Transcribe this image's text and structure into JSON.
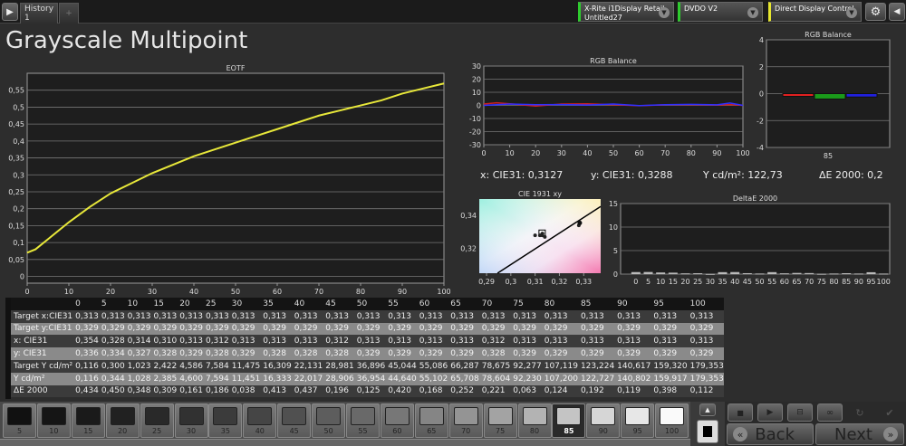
{
  "topbar": {
    "history_tab": "History 1",
    "add_tab": "+",
    "meter": {
      "line1": "X-Rite i1Display Retail",
      "line2": "Untitled27",
      "status_color": "#2ecc2e"
    },
    "source": {
      "label": "DVDO V2",
      "status_color": "#2ecc2e"
    },
    "display": {
      "label": "Direct Display Control",
      "status_color": "#e6e62e"
    }
  },
  "title": "Grayscale Multipoint",
  "readouts": {
    "x": "x: CIE31: 0,3127",
    "y": "y: CIE31: 0,3288",
    "Y": "Y cd/m²: 122,73",
    "de": "ΔE 2000: 0,2"
  },
  "chart_data": [
    {
      "type": "line",
      "title": "EOTF",
      "x": [
        0,
        2,
        5,
        8,
        10,
        15,
        20,
        25,
        30,
        35,
        40,
        45,
        50,
        55,
        60,
        65,
        70,
        75,
        80,
        85,
        90,
        95,
        100
      ],
      "values": [
        0.07,
        0.08,
        0.11,
        0.14,
        0.16,
        0.205,
        0.245,
        0.275,
        0.305,
        0.33,
        0.355,
        0.375,
        0.395,
        0.415,
        0.435,
        0.455,
        0.475,
        0.49,
        0.505,
        0.52,
        0.54,
        0.555,
        0.57
      ],
      "xlim": [
        0,
        100
      ],
      "ylim": [
        -0.02,
        0.6
      ],
      "xticks": [
        "0",
        "10",
        "20",
        "30",
        "40",
        "50",
        "60",
        "70",
        "80",
        "90",
        "100"
      ],
      "yticks": [
        "0",
        "0,05",
        "0,1",
        "0,15",
        "0,2",
        "0,25",
        "0,3",
        "0,35",
        "0,4",
        "0,45",
        "0,5",
        "0,55"
      ],
      "color": "#e8e83a"
    },
    {
      "type": "line",
      "title": "RGB Balance",
      "x": [
        0,
        5,
        10,
        20,
        30,
        40,
        50,
        60,
        70,
        80,
        90,
        95,
        100
      ],
      "series": [
        {
          "name": "Red",
          "color": "#d02020",
          "values": [
            1,
            2,
            1.2,
            -0.5,
            1,
            1.2,
            0.5,
            -0.3,
            0.4,
            0.5,
            0.3,
            0.6,
            0
          ]
        },
        {
          "name": "Blue",
          "color": "#3030ff",
          "values": [
            0,
            0.5,
            1,
            0.5,
            0.6,
            0.3,
            1,
            -0.2,
            0.5,
            0.8,
            0.4,
            1.8,
            0
          ]
        }
      ],
      "ylim": [
        -30,
        30
      ],
      "xticks": [
        "0",
        "10",
        "20",
        "30",
        "40",
        "50",
        "60",
        "70",
        "80",
        "90",
        "100"
      ],
      "yticks": [
        "-30",
        "-20",
        "-10",
        "0",
        "10",
        "20",
        "30"
      ]
    },
    {
      "type": "bar",
      "title": "RGB Balance",
      "categories": [
        "85"
      ],
      "series": [
        {
          "name": "Red",
          "color": "#e02020",
          "value": -0.2
        },
        {
          "name": "Green",
          "color": "#1a9a1a",
          "value": -0.4
        },
        {
          "name": "Blue",
          "color": "#2020e0",
          "value": -0.25
        }
      ],
      "ylim": [
        -4,
        4
      ],
      "yticks": [
        "-4",
        "-2",
        "0",
        "2",
        "4"
      ]
    },
    {
      "type": "scatter",
      "title": "CIE 1931 xy",
      "xlim": [
        0.287,
        0.337
      ],
      "ylim": [
        0.305,
        0.35
      ],
      "xticks": [
        "0,29",
        "0,3",
        "0,31",
        "0,32",
        "0,33"
      ],
      "yticks": [
        "0,32",
        "0,34"
      ],
      "target": [
        0.3127,
        0.329
      ],
      "points": [
        [
          0.354,
          0.336
        ],
        [
          0.328,
          0.334
        ],
        [
          0.314,
          0.327
        ],
        [
          0.31,
          0.328
        ],
        [
          0.313,
          0.329
        ],
        [
          0.312,
          0.328
        ],
        [
          0.313,
          0.329
        ],
        [
          0.313,
          0.328
        ]
      ],
      "highlight": [
        0.3284,
        0.3355
      ]
    },
    {
      "type": "bar",
      "title": "DeltaE 2000",
      "categories": [
        "0",
        "5",
        "10",
        "15",
        "20",
        "25",
        "30",
        "35",
        "40",
        "45",
        "50",
        "55",
        "60",
        "65",
        "70",
        "75",
        "80",
        "85",
        "90",
        "95",
        "100"
      ],
      "values": [
        0.434,
        0.45,
        0.348,
        0.309,
        0.161,
        0.186,
        0.038,
        0.413,
        0.437,
        0.196,
        0.125,
        0.42,
        0.168,
        0.252,
        0.221,
        0.063,
        0.124,
        0.192,
        0.119,
        0.398,
        0.112
      ],
      "ylim": [
        0,
        15
      ],
      "yticks": [
        "0",
        "5",
        "10",
        "15"
      ]
    }
  ],
  "table": {
    "headers": [
      "",
      "0",
      "5",
      "10",
      "15",
      "20",
      "25",
      "30",
      "35",
      "40",
      "45",
      "50",
      "55",
      "60",
      "65",
      "70",
      "75",
      "80",
      "85",
      "90",
      "95",
      "100"
    ],
    "rows": [
      [
        "Target x:CIE31",
        "0,313",
        "0,313",
        "0,313",
        "0,313",
        "0,313",
        "0,313",
        "0,313",
        "0,313",
        "0,313",
        "0,313",
        "0,313",
        "0,313",
        "0,313",
        "0,313",
        "0,313",
        "0,313",
        "0,313",
        "0,313",
        "0,313",
        "0,313",
        "0,313"
      ],
      [
        "Target y:CIE31",
        "0,329",
        "0,329",
        "0,329",
        "0,329",
        "0,329",
        "0,329",
        "0,329",
        "0,329",
        "0,329",
        "0,329",
        "0,329",
        "0,329",
        "0,329",
        "0,329",
        "0,329",
        "0,329",
        "0,329",
        "0,329",
        "0,329",
        "0,329",
        "0,329"
      ],
      [
        "x: CIE31",
        "0,354",
        "0,328",
        "0,314",
        "0,310",
        "0,313",
        "0,312",
        "0,313",
        "0,313",
        "0,313",
        "0,312",
        "0,313",
        "0,313",
        "0,313",
        "0,313",
        "0,312",
        "0,313",
        "0,313",
        "0,313",
        "0,313",
        "0,313",
        "0,313"
      ],
      [
        "y: CIE31",
        "0,336",
        "0,334",
        "0,327",
        "0,328",
        "0,329",
        "0,328",
        "0,329",
        "0,328",
        "0,328",
        "0,328",
        "0,329",
        "0,329",
        "0,329",
        "0,329",
        "0,328",
        "0,329",
        "0,329",
        "0,329",
        "0,329",
        "0,329",
        "0,329"
      ],
      [
        "Target Y cd/m²",
        "0,116",
        "0,300",
        "1,023",
        "2,422",
        "4,586",
        "7,584",
        "11,475",
        "16,309",
        "22,131",
        "28,981",
        "36,896",
        "45,044",
        "55,086",
        "66,287",
        "78,675",
        "92,277",
        "107,119",
        "123,224",
        "140,617",
        "159,320",
        "179,353"
      ],
      [
        "Y cd/m²",
        "0,116",
        "0,344",
        "1,028",
        "2,385",
        "4,600",
        "7,594",
        "11,451",
        "16,333",
        "22,017",
        "28,906",
        "36,954",
        "44,640",
        "55,102",
        "65,708",
        "78,604",
        "92,230",
        "107,200",
        "122,727",
        "140,802",
        "159,917",
        "179,353"
      ],
      [
        "ΔE 2000",
        "0,434",
        "0,450",
        "0,348",
        "0,309",
        "0,161",
        "0,186",
        "0,038",
        "0,413",
        "0,437",
        "0,196",
        "0,125",
        "0,420",
        "0,168",
        "0,252",
        "0,221",
        "0,063",
        "0,124",
        "0,192",
        "0,119",
        "0,398",
        "0,112"
      ]
    ]
  },
  "swatches": {
    "labels": [
      "5",
      "10",
      "15",
      "20",
      "25",
      "30",
      "35",
      "40",
      "45",
      "50",
      "55",
      "60",
      "65",
      "70",
      "75",
      "80",
      "85",
      "90",
      "95",
      "100"
    ],
    "selected": "85"
  },
  "controls": {
    "back": "Back",
    "next": "Next",
    "back_icon": "«",
    "next_icon": "»"
  }
}
